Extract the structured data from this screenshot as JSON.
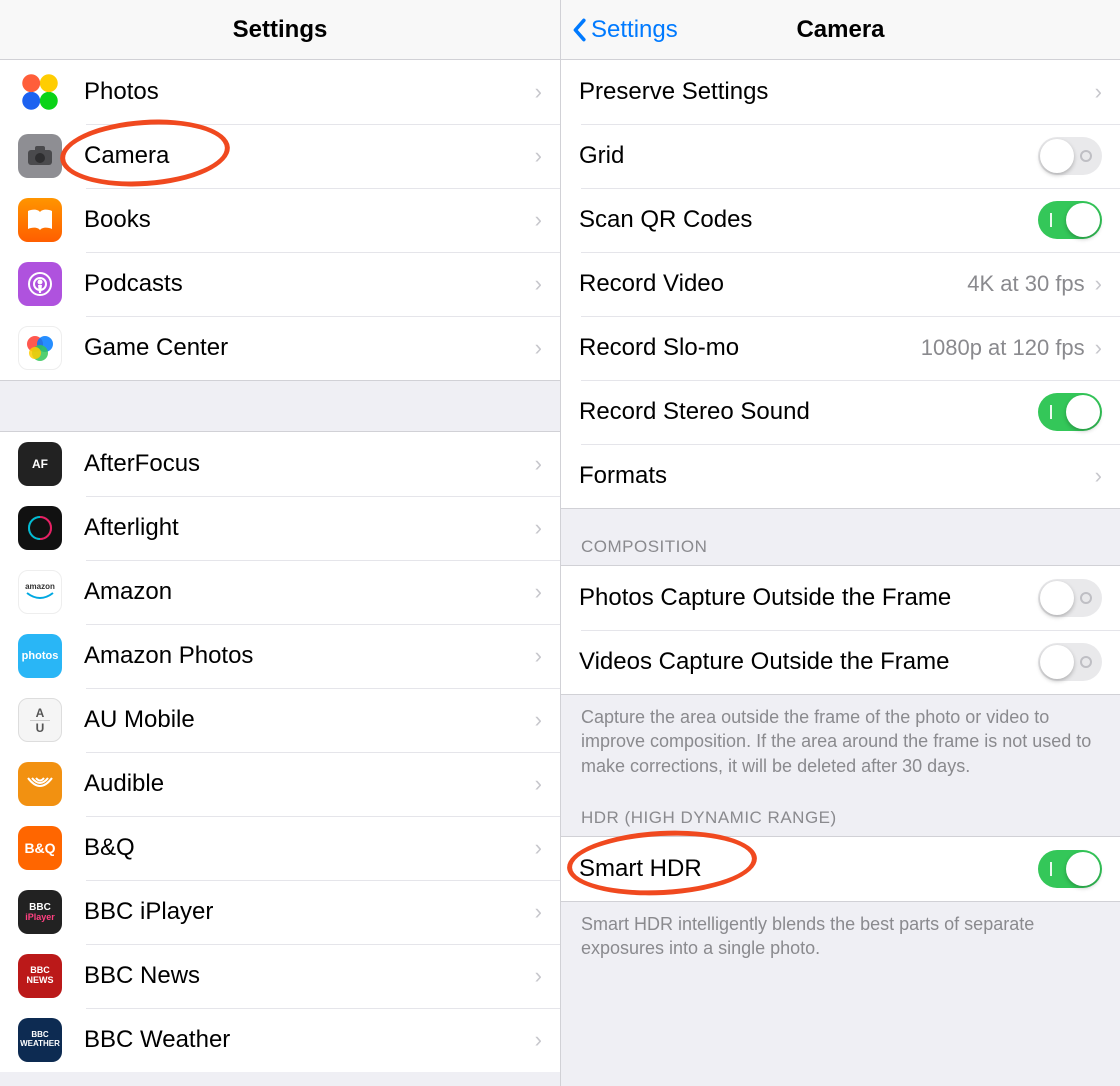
{
  "left": {
    "title": "Settings",
    "group1": [
      {
        "label": "Photos"
      },
      {
        "label": "Camera",
        "highlighted": true
      },
      {
        "label": "Books"
      },
      {
        "label": "Podcasts"
      },
      {
        "label": "Game Center"
      }
    ],
    "group2": [
      {
        "label": "AfterFocus"
      },
      {
        "label": "Afterlight"
      },
      {
        "label": "Amazon"
      },
      {
        "label": "Amazon Photos"
      },
      {
        "label": "AU Mobile"
      },
      {
        "label": "Audible"
      },
      {
        "label": "B&Q"
      },
      {
        "label": "BBC iPlayer"
      },
      {
        "label": "BBC News"
      },
      {
        "label": "BBC Weather"
      }
    ]
  },
  "right": {
    "back": "Settings",
    "title": "Camera",
    "rows": {
      "preserve": "Preserve Settings",
      "grid": "Grid",
      "scanqr": "Scan QR Codes",
      "recvideo_label": "Record Video",
      "recvideo_value": "4K at 30 fps",
      "recslomo_label": "Record Slo-mo",
      "recslomo_value": "1080p at 120 fps",
      "stereo": "Record Stereo Sound",
      "formats": "Formats"
    },
    "composition": {
      "header": "COMPOSITION",
      "photos_outside": "Photos Capture Outside the Frame",
      "videos_outside": "Videos Capture Outside the Frame",
      "footer": "Capture the area outside the frame of the photo or video to improve composition. If the area around the frame is not used to make corrections, it will be deleted after 30 days."
    },
    "hdr": {
      "header": "HDR (HIGH DYNAMIC RANGE)",
      "smarthdr": "Smart HDR",
      "footer": "Smart HDR intelligently blends the best parts of separate exposures into a single photo."
    },
    "toggles": {
      "grid": false,
      "scanqr": true,
      "stereo": true,
      "photos_outside": false,
      "videos_outside": false,
      "smarthdr": true
    }
  }
}
